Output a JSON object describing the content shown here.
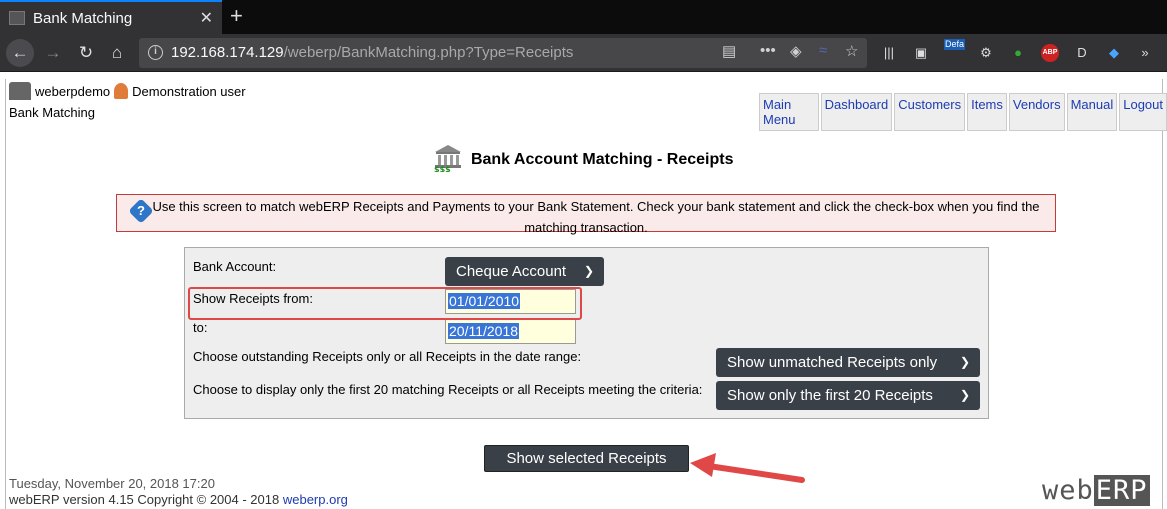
{
  "browser": {
    "tab_title": "Bank Matching",
    "new_tab": "+",
    "close_tab": "✕",
    "url_host": "192.168.174.129",
    "url_path": "/weberp/BankMatching.php?Type=Receipts",
    "badge": "Defa",
    "abp": "ABP"
  },
  "header": {
    "username": "weberpdemo",
    "realname": "Demonstration user",
    "breadcrumb": "Bank Matching",
    "menu": [
      "Main Menu",
      "Dashboard",
      "Customers",
      "Items",
      "Vendors",
      "Manual",
      "Logout"
    ]
  },
  "main": {
    "title": "Bank Account Matching - Receipts",
    "info": "Use this screen to match webERP Receipts and Payments to your Bank Statement. Check your bank statement and click the check-box when you find the matching transaction.",
    "form": {
      "bank_account_label": "Bank Account:",
      "bank_account_value": "Cheque Account",
      "from_label": "Show Receipts from:",
      "from_value": "01/01/2010",
      "to_label": "to:",
      "to_value": "20/11/2018",
      "outstanding_label": "Choose outstanding Receipts only or all Receipts in the date range:",
      "outstanding_value": "Show unmatched Receipts only",
      "first20_label": "Choose to display only the first 20 matching Receipts or all Receipts meeting the criteria:",
      "first20_value": "Show only the first 20 Receipts"
    },
    "submit_label": "Show selected Receipts"
  },
  "footer": {
    "datetime": "Tuesday, November 20, 2018 17:20",
    "version": "webERP version 4.15 Copyright © 2004 - 2018 ",
    "link": "weberp.org",
    "logo_web": "web",
    "logo_erp": "ERP"
  },
  "colors": {
    "accent": "#0a84ff",
    "highlight_box": "#e04848",
    "button": "#3a4048"
  }
}
